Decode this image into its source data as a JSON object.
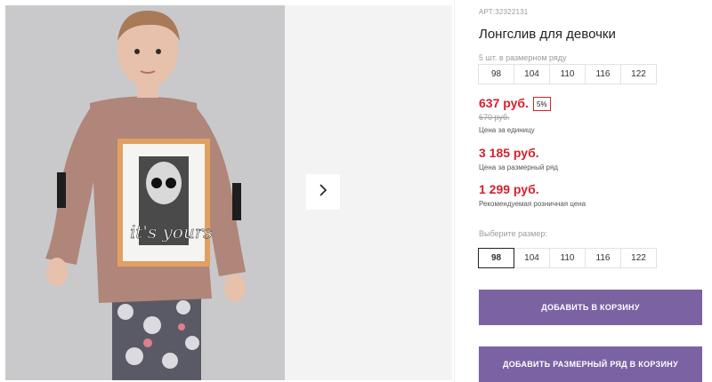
{
  "product": {
    "sku_label": "АРТ:",
    "sku": "32322131",
    "title": "Лонгслив для девочки",
    "range_caption": "5 шт. в размерном ряду",
    "range_sizes": [
      "98",
      "104",
      "110",
      "116",
      "122"
    ],
    "price": "637 руб.",
    "discount_badge": "5%",
    "old_price": "670 руб.",
    "price_note": "Цена за единицу",
    "range_price": "3 185 руб.",
    "range_price_note": "Цена за размерный ряд",
    "retail_price": "1 299 руб.",
    "retail_price_note": "Рекомендуемая розничная цена",
    "choose_size_label": "Выберите размер:",
    "sizes": [
      "98",
      "104",
      "110",
      "116",
      "122"
    ],
    "selected_size": "98",
    "add_to_cart_label": "ДОБАВИТЬ В КОРЗИНУ",
    "add_range_label": "ДОБАВИТЬ РАЗМЕРНЫЙ РЯД В КОРЗИНУ"
  },
  "gallery": {
    "next_icon": "chevron-right-icon",
    "print_text": "it's yours"
  },
  "colors": {
    "price_red": "#d6202c",
    "button_purple": "#7b62a3",
    "shirt": "#b0857a"
  }
}
